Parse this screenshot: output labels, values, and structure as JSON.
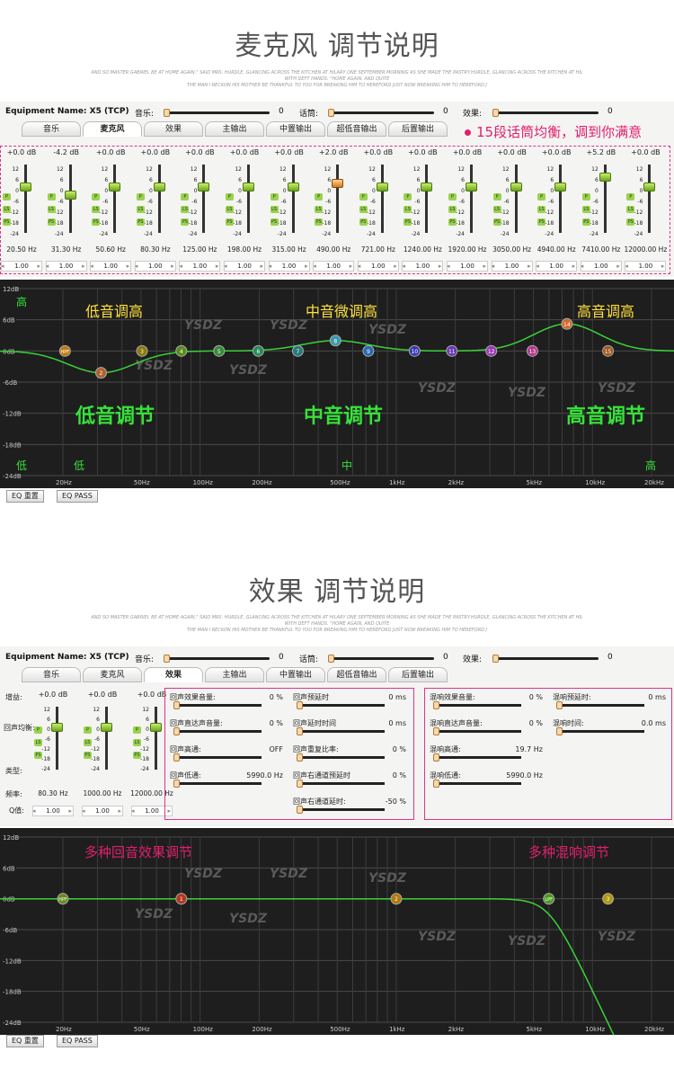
{
  "section1": {
    "title": "麦克风 调节说明",
    "subtitle": [
      "AND SO MASTER GABRIEL BE AT HOME AGAIN,\" SAID MRS. HURDLE, GLANCING ACROSS THE KITCHEN AT HILARY ONE SEPTEMBER MORNING AS SHE MADE THE PASTRY.HURDLE, GLANCING ACROSS THE KITCHEN AT HIL",
      "WITH DEFT HANDS. \"HOME AGAIN, AND QUITE",
      "THE MAN I RECKON HIS MOTHER BE THANKFUL TO YOU FOR BREAKING HIM TO HEREFORD JUST NOW BREAKING HIM TO HEREFORD J"
    ]
  },
  "section2": {
    "title": "效果 调节说明"
  },
  "toolbar": {
    "equipment": "Equipment Name: X5 (TCP)",
    "music_label": "音乐:",
    "music_value": "0",
    "talk_label": "话筒:",
    "talk_value": "0",
    "effect_label": "效果:",
    "effect_value": "0"
  },
  "tabs": [
    "音乐",
    "麦克风",
    "效果",
    "主输出",
    "中置输出",
    "超低音输出",
    "后置输出"
  ],
  "eq": {
    "callout": "15段话筒均衡，调到你满意",
    "ticks": [
      "12",
      "6",
      "0",
      "-6",
      "-12",
      "-18",
      "-24"
    ],
    "bands": [
      {
        "db": "+0.0 dB",
        "hz": "20.50 Hz",
        "q": "1.00",
        "level": 0
      },
      {
        "db": "-4.2 dB",
        "hz": "31.30 Hz",
        "q": "1.00",
        "level": -4.2
      },
      {
        "db": "+0.0 dB",
        "hz": "50.60 Hz",
        "q": "1.00",
        "level": 0
      },
      {
        "db": "+0.0 dB",
        "hz": "80.30 Hz",
        "q": "1.00",
        "level": 0
      },
      {
        "db": "+0.0 dB",
        "hz": "125.00 Hz",
        "q": "1.00",
        "level": 0
      },
      {
        "db": "+0.0 dB",
        "hz": "198.00 Hz",
        "q": "1.00",
        "level": 0
      },
      {
        "db": "+0.0 dB",
        "hz": "315.00 Hz",
        "q": "1.00",
        "level": 0
      },
      {
        "db": "+2.0 dB",
        "hz": "490.00 Hz",
        "q": "1.00",
        "level": 2
      },
      {
        "db": "+0.0 dB",
        "hz": "721.00 Hz",
        "q": "1.00",
        "level": 0
      },
      {
        "db": "+0.0 dB",
        "hz": "1240.00 Hz",
        "q": "1.00",
        "level": 0
      },
      {
        "db": "+0.0 dB",
        "hz": "1920.00 Hz",
        "q": "1.00",
        "level": 0
      },
      {
        "db": "+0.0 dB",
        "hz": "3050.00 Hz",
        "q": "1.00",
        "level": 0
      },
      {
        "db": "+0.0 dB",
        "hz": "4940.00 Hz",
        "q": "1.00",
        "level": 0
      },
      {
        "db": "+5.2 dB",
        "hz": "7410.00 Hz",
        "q": "1.00",
        "level": 5.2
      },
      {
        "db": "+0.0 dB",
        "hz": "12000.00 Hz",
        "q": "1.00",
        "level": 0
      }
    ]
  },
  "graph1": {
    "ylabels": [
      "12dB",
      "6dB",
      "0dB",
      "-6dB",
      "-12dB",
      "-18dB",
      "-24dB"
    ],
    "xlabels": [
      "20Hz",
      "50Hz",
      "100Hz",
      "200Hz",
      "500Hz",
      "1kHz",
      "2kHz",
      "5kHz",
      "10kHz",
      "20kHz"
    ],
    "high": "高",
    "low": "低",
    "low2": "低",
    "mid": "中",
    "high2": "高",
    "t_low": "低音调高",
    "t_mid": "中音微调高",
    "t_high": "高音调高",
    "b_low": "低音调节",
    "b_mid": "中音调节",
    "b_high": "高音调节",
    "watermark": "YSDZ",
    "nodes": [
      "HPF",
      "2",
      "3",
      "4",
      "5",
      "6",
      "7",
      "8",
      "9",
      "10",
      "11",
      "12",
      "13",
      "14",
      "15"
    ]
  },
  "buttons": {
    "eq_reset": "EQ 重置",
    "eq_pass": "EQ PASS"
  },
  "fx": {
    "gain_label": "增益:",
    "echo_eq_label": "回声均衡:",
    "type_label": "类型:",
    "freq_label": "频率:",
    "q_label": "Q值:",
    "bands": [
      {
        "db": "+0.0 dB",
        "hz": "80.30 Hz",
        "q": "1.00"
      },
      {
        "db": "+0.0 dB",
        "hz": "1000.00 Hz",
        "q": "1.00"
      },
      {
        "db": "+0.0 dB",
        "hz": "12000.00 Hz",
        "q": "1.00"
      }
    ],
    "echo_left": [
      {
        "label": "回声效果音量:",
        "value": "0 %"
      },
      {
        "label": "回声直达声音量:",
        "value": "0 %"
      },
      {
        "label": "回声高通:",
        "value": "OFF"
      },
      {
        "label": "回声低通:",
        "value": "5990.0 Hz"
      }
    ],
    "echo_right": [
      {
        "label": "回声预延时",
        "value": "0 ms"
      },
      {
        "label": "回声延时时间",
        "value": "0 ms"
      },
      {
        "label": "回声重复比率:",
        "value": "0 %"
      },
      {
        "label": "回声右通道预延时",
        "value": "0 %"
      },
      {
        "label": "回声右通道延时:",
        "value": "-50 %"
      }
    ],
    "rev_left": [
      {
        "label": "混响效果音量:",
        "value": "0 %"
      },
      {
        "label": "混响直达声音量:",
        "value": "0 %"
      },
      {
        "label": "混响高通:",
        "value": "19.7 Hz"
      },
      {
        "label": "混响低通:",
        "value": "5990.0 Hz"
      }
    ],
    "rev_right": [
      {
        "label": "混响预延时:",
        "value": "0 ms"
      },
      {
        "label": "混响时间:",
        "value": "0.0 ms"
      }
    ],
    "callout_echo": "多种回音效果调节",
    "callout_rev": "多种混响调节"
  },
  "graph2": {
    "nodes": [
      "HPF",
      "1",
      "2",
      "LPF",
      "3"
    ]
  }
}
